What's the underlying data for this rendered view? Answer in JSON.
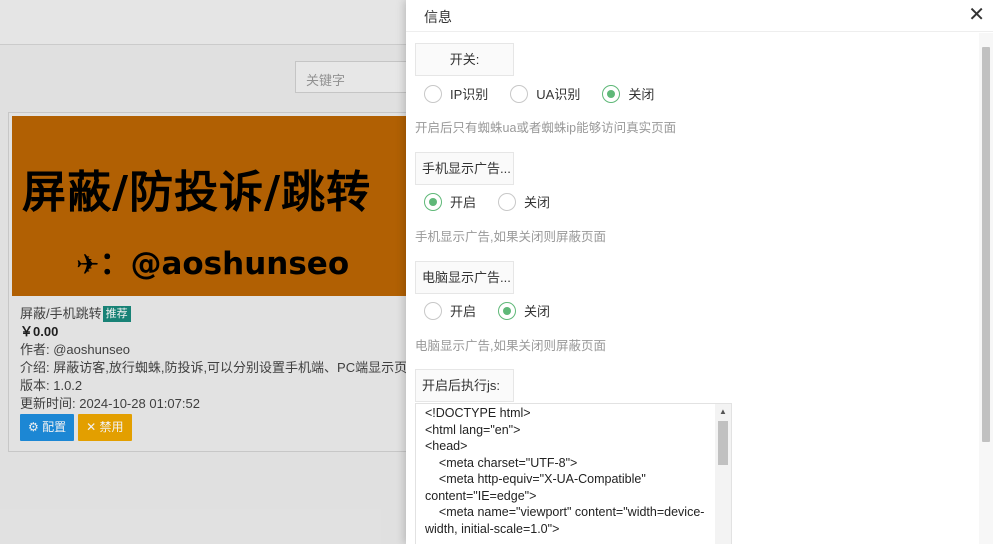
{
  "background": {
    "search_placeholder": "关键字",
    "card": {
      "banner_title": "屏蔽/防投诉/跳转",
      "banner_plane_icon": "airplane-icon",
      "banner_sub": "：@aoshunseo",
      "name": "屏蔽/手机跳转",
      "badge": "推荐",
      "price": "￥0.00",
      "author": "作者: @aoshunseo",
      "intro": "介绍: 屏蔽访客,放行蜘蛛,防投诉,可以分别设置手机端、PC端显示页面",
      "version": "版本: 1.0.2",
      "updated": "更新时间: 2024-10-28 01:07:52",
      "config_btn": "配置",
      "disable_btn": "禁用"
    }
  },
  "dialog": {
    "title": "信息",
    "close_icon": "close-icon",
    "switch": {
      "label": "开关:",
      "options": [
        "IP识别",
        "UA识别",
        "关闭"
      ],
      "selected": 2,
      "hint": "开启后只有蜘蛛ua或者蜘蛛ip能够访问真实页面"
    },
    "mobile_ads": {
      "label": "手机显示广告...",
      "options": [
        "开启",
        "关闭"
      ],
      "selected": 0,
      "hint": "手机显示广告,如果关闭则屏蔽页面"
    },
    "pc_ads": {
      "label": "电脑显示广告...",
      "options": [
        "开启",
        "关闭"
      ],
      "selected": 1,
      "hint": "电脑显示广告,如果关闭则屏蔽页面"
    },
    "js": {
      "label": "开启后执行js:",
      "code": "<!DOCTYPE html>\n<html lang=\"en\">\n<head>\n    <meta charset=\"UTF-8\">\n    <meta http-equiv=\"X-UA-Compatible\" content=\"IE=edge\">\n    <meta name=\"viewport\" content=\"width=device-width, initial-scale=1.0\">"
    }
  },
  "colors": {
    "accent_green": "#5fb878",
    "banner_orange": "#bb6604",
    "btn_blue": "#1e8fe0",
    "btn_orange": "#f0a800",
    "badge_teal": "#1a8a7d"
  }
}
